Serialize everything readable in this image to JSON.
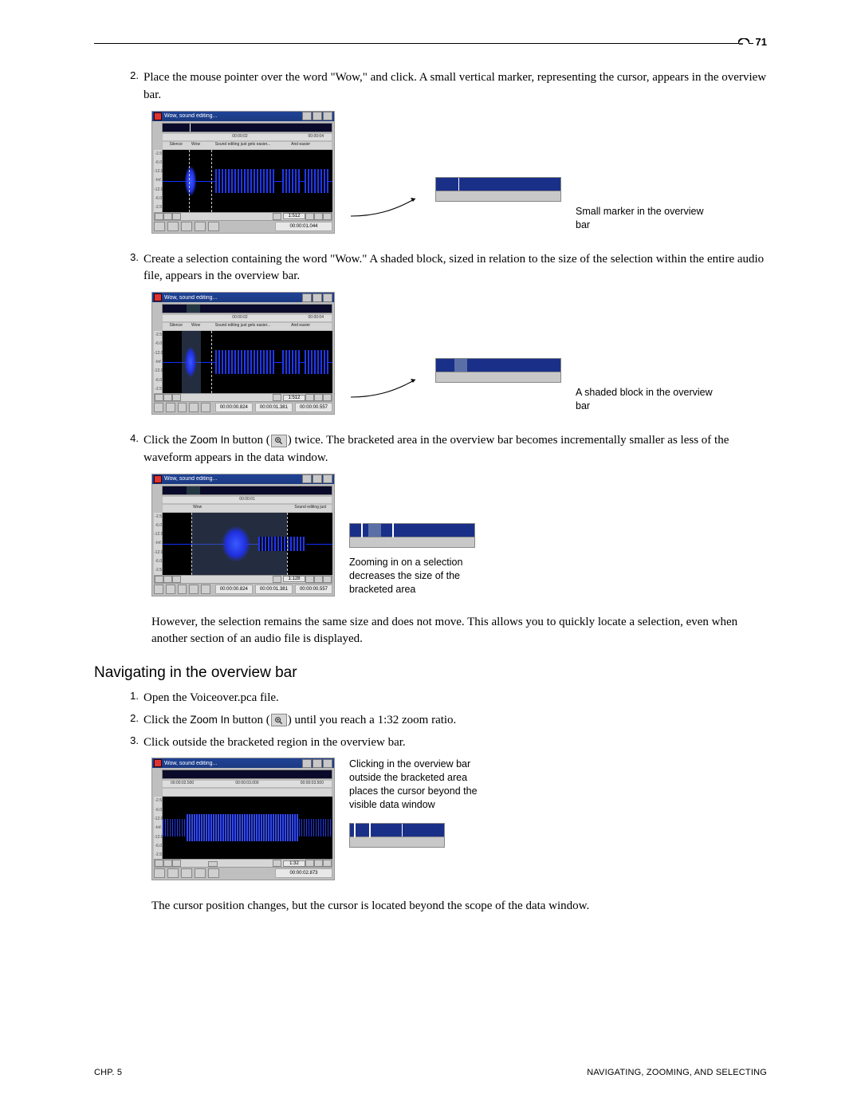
{
  "page_number": "71",
  "footer_left": "CHP. 5",
  "footer_right": "NAVIGATING, ZOOMING, AND SELECTING",
  "section1": {
    "step2_num": "2.",
    "step2": "Place the mouse pointer over the word \"Wow,\" and click. A small vertical marker, representing the cursor, appears in the overview bar.",
    "step3_num": "3.",
    "step3": "Create a selection containing the word \"Wow.\" A shaded block, sized in relation to the size of the selection within the entire audio file, appears in the overview bar.",
    "step4_num": "4.",
    "step4_pre": "Click the ",
    "step4_btn": "Zoom In",
    "step4_mid": " button (",
    "step4_post": ") twice. The bracketed area in the overview bar becomes incrementally smaller as less of the waveform appears in the data window.",
    "after4": "However, the selection remains the same size and does not move. This allows you to quickly locate a selection, even when another section of an audio file is displayed."
  },
  "heading_nav": "Navigating in the overview bar",
  "nav": {
    "s1_num": "1.",
    "s1": "Open the Voiceover.pca file.",
    "s2_num": "2.",
    "s2_pre": "Click the ",
    "s2_btn": "Zoom In",
    "s2_mid": " button (",
    "s2_post": ") until you reach a 1:32 zoom ratio.",
    "s3_num": "3.",
    "s3": "Click outside the bracketed region in the overview bar.",
    "after": "The cursor position changes, but the cursor is located beyond the scope of the data window."
  },
  "captions": {
    "c1": "Small marker in the overview bar",
    "c2": "A shaded block in the overview bar",
    "c3": "Zooming in on a selection decreases the size of the bracketed area",
    "c4": "Clicking in the overview bar outside the bracketed area places the cursor beyond the visible data window"
  },
  "win": {
    "title": "Wow, sound editing...",
    "time_a": "00:00:02",
    "time_b": "00:00:04",
    "time_c": "00:00:01",
    "regions": {
      "r1": "Silence",
      "r2": "Wow",
      "r3": "Sound editing just gets easier...",
      "r4": "And easier"
    },
    "axis": [
      "-2.5",
      "-6.0",
      "-12.0",
      "-Inf.",
      "-12.0",
      "-6.0",
      "-2.5"
    ],
    "zoom1": "1:512",
    "zoom2": "1:128",
    "zoom3": "1:32",
    "status_time_a": "00:00:01.044",
    "status_sel_a": "00:00:00.824",
    "status_sel_b": "00:00:01.381",
    "status_sel_c": "00:00:00.557",
    "status_time_d": "00:00:02.873",
    "nav_time_a": "00:00:02.500",
    "nav_time_b": "00:00:03.000",
    "nav_time_c": "00:00:03.500"
  }
}
